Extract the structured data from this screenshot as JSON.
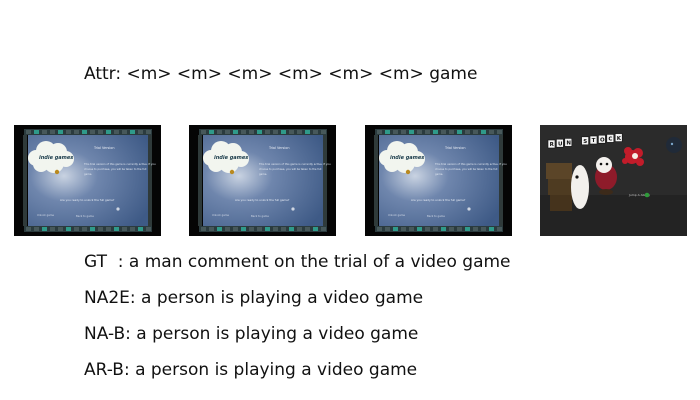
{
  "attr_line": "Attr: <m> <m> <m> <m> <m> <m> game",
  "frames": [
    {
      "kind": "menu",
      "cloud_text": "indie games",
      "panel_title": "Trial Version",
      "panel_body": [
        "This trial version of this game is currently active. If you",
        "choose to purchase, you will be taken to the full",
        "game."
      ],
      "panel_cta": "Are you ready to unlock the full game?",
      "footer_left": "Unlock game",
      "footer_right": "Back to game"
    },
    {
      "kind": "menu",
      "cloud_text": "indie games",
      "panel_title": "Trial Version",
      "panel_body": [
        "This trial version of this game is currently active. If you",
        "choose to purchase, you will be taken to the full",
        "game."
      ],
      "panel_cta": "Are you ready to unlock the full game?",
      "footer_left": "Unlock game",
      "footer_right": "Back to game"
    },
    {
      "kind": "menu",
      "cloud_text": "indie games",
      "panel_title": "Trial Version",
      "panel_body": [
        "This trial version of this game is currently active. If you",
        "choose to purchase, you will be taken to the full",
        "game."
      ],
      "panel_cta": "Are you ready to unlock the full game?",
      "footer_left": "Unlock game",
      "footer_right": "Back to game"
    },
    {
      "kind": "gameplay",
      "title_letters": [
        "R",
        "U",
        "N",
        "",
        "S",
        "T",
        "O",
        "C",
        "K"
      ],
      "controls_hint": "Jump  A   Ability"
    }
  ],
  "captions": {
    "gt": "GT  : a man comment on the trial of a video game",
    "na2e": "NA2E: a person is playing a video game",
    "nab": "NA-B: a person is playing a video game",
    "arb": "AR-B: a person is playing a video game"
  },
  "colors": {
    "menu_panel": "#3e5a86",
    "menu_border_tile": "#2f9a8a",
    "gameplay_bg": "#2b2b2b"
  }
}
